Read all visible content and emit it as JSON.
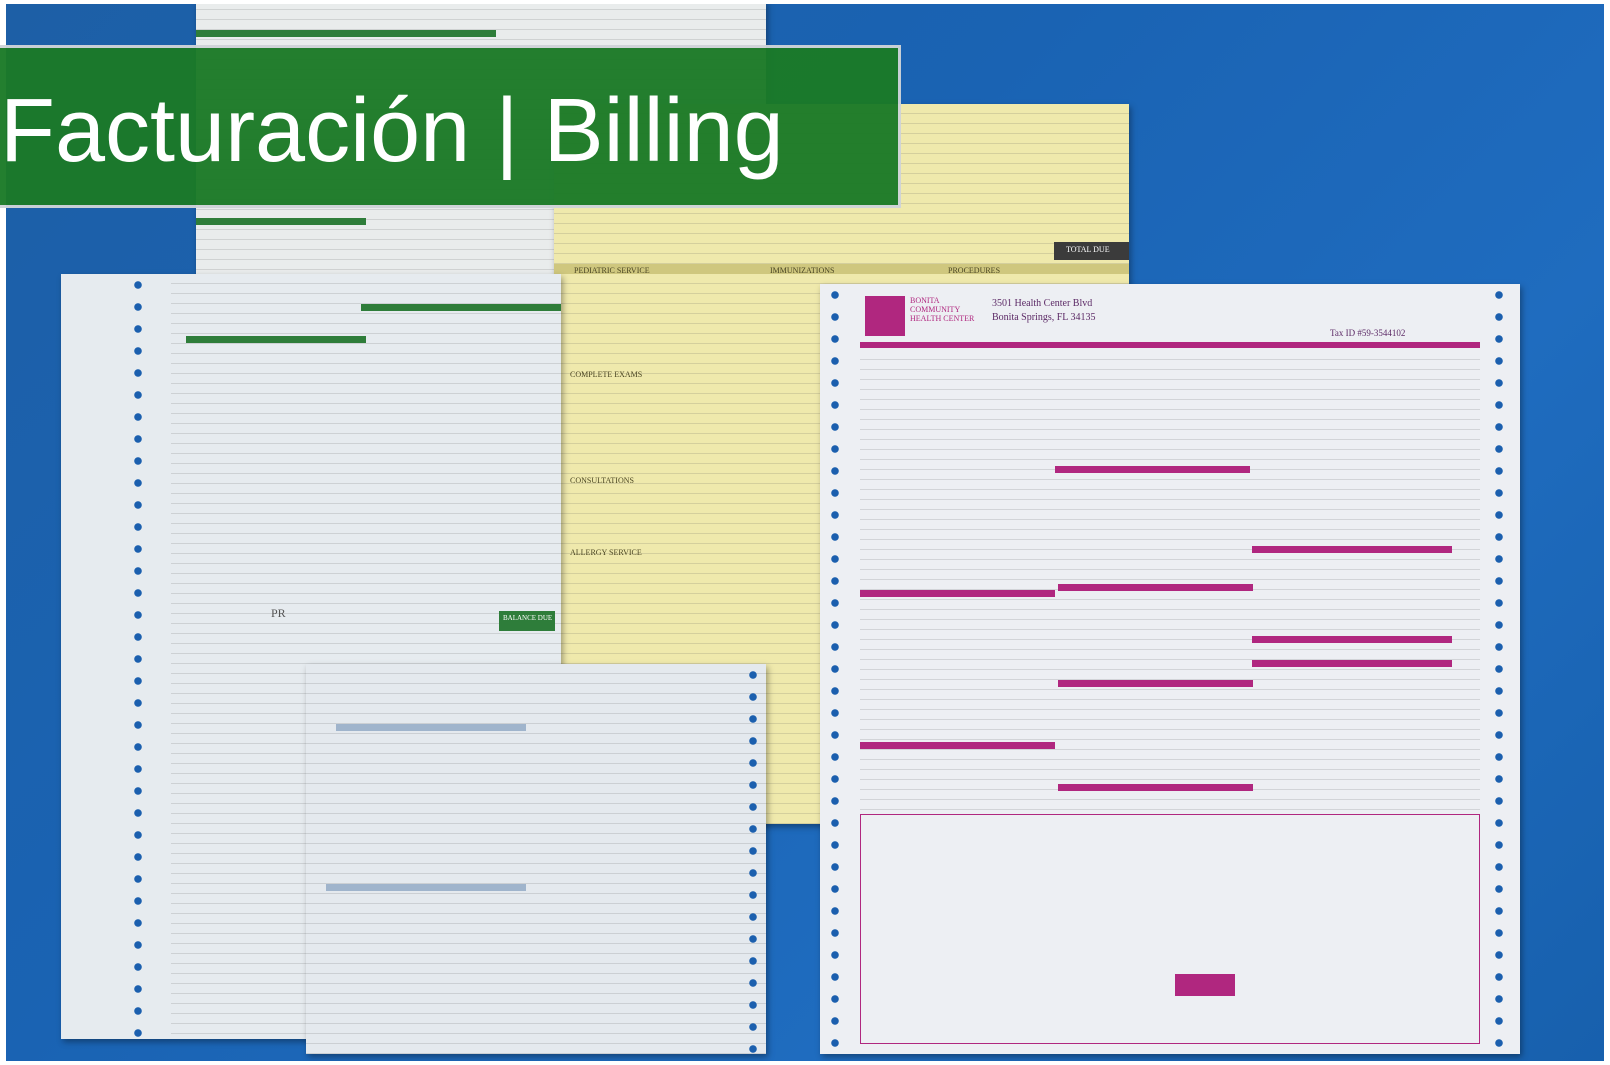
{
  "slide": {
    "title": "Facturación | Billing"
  },
  "forms": {
    "right_form": {
      "org_name": "BONITA COMMUNITY HEALTH CENTER",
      "address_line1": "3501 Health Center Blvd",
      "address_line2": "Bonita Springs, FL 34135",
      "tax_id": "Tax ID #59-3544102"
    },
    "left_form": {
      "label_pr": "PR",
      "balance_due": "BALANCE DUE"
    },
    "yellow_form": {
      "pediatric_service": "PEDIATRIC SERVICE",
      "complete_exams": "COMPLETE EXAMS",
      "consultations": "CONSULTATIONS",
      "allergy_service": "ALLERGY SERVICE",
      "immunizations": "IMMUNIZATIONS",
      "procedures": "PROCEDURES",
      "total_due": "TOTAL DUE"
    }
  },
  "colors": {
    "background_blue": "#1a63b3",
    "title_green": "#1b7a27",
    "form_magenta": "#b0277f",
    "form_green": "#2e7d3a",
    "yellow_paper": "#efe9ac"
  }
}
